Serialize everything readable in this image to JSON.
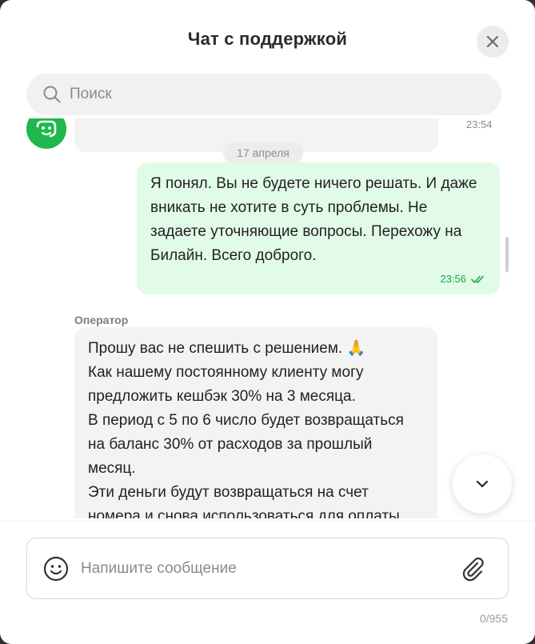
{
  "header": {
    "title": "Чат с поддержкой"
  },
  "search": {
    "placeholder": "Поиск"
  },
  "chat": {
    "prev_message_time": "23:54",
    "date_divider": "17 апреля",
    "user_message": {
      "text": "Я понял. Вы не будете ничего решать. И даже\nвникать не хотите в суть проблемы. Не\nзадаете уточняющие вопросы. Перехожу на\nБилайн. Всего доброго.",
      "time": "23:56",
      "status": "read"
    },
    "operator_message": {
      "sender": "Оператор",
      "text": "Прошу вас не спешить с решением. 🙏\nКак нашему постоянному клиенту могу\nпредложить кешбэк 30% на 3 месяца.\nВ период с 5 по 6 число будет возвращаться\nна баланс 30% от расходов за прошлый\nмесяц.\nЭти деньги будут возвращаться на счет\nномера и снова использоваться для оплаты"
    }
  },
  "composer": {
    "placeholder": "Напишите сообщение",
    "counter": "0/955"
  },
  "colors": {
    "accent": "#1fb84d",
    "user_bubble": "#e1fbe8",
    "operator_bubble": "#f3f3f3"
  },
  "icons": [
    "close-icon",
    "search-icon",
    "bot-avatar-icon",
    "double-check-icon",
    "chevron-down-icon",
    "emoji-icon",
    "paperclip-icon"
  ]
}
